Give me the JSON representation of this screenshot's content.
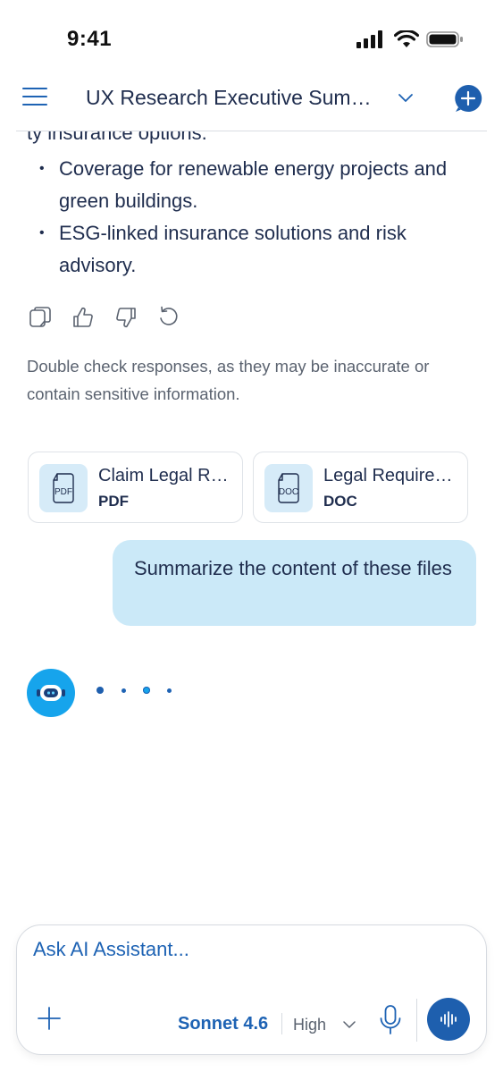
{
  "status_bar": {
    "time": "9:41"
  },
  "header": {
    "title": "UX Research Executive Sum…",
    "menu_icon": "hamburger-menu-icon",
    "dropdown_icon": "chevron-down-icon",
    "new_chat_icon": "chat-plus-icon"
  },
  "conversation": {
    "previous_answer_tail": "ty insurance options.",
    "bullets": [
      "Coverage for renewable energy projects and green buildings.",
      "ESG-linked insurance solutions and risk advisory."
    ],
    "bullet_marker": "•",
    "actions": [
      {
        "name": "copy-icon"
      },
      {
        "name": "thumbs-up-icon"
      },
      {
        "name": "thumbs-down-icon"
      },
      {
        "name": "regenerate-icon"
      }
    ],
    "disclaimer": "Double check responses, as they may be inaccurate or contain sensitive information.",
    "attachments": [
      {
        "name": "Claim Legal R…",
        "type": "PDF",
        "icon_text": "PDF"
      },
      {
        "name": "Legal Require…",
        "type": "DOC",
        "icon_text": "DOC"
      }
    ],
    "user_message": "Summarize the content of these files",
    "assistant_status": "typing"
  },
  "composer": {
    "placeholder": "Ask AI Assistant...",
    "model": "Sonnet 4.6",
    "effort": "High"
  },
  "colors": {
    "accent": "#1e63b4",
    "user_bubble": "#cbe9f8",
    "avatar": "#16a4ec",
    "text": "#1f2d4e",
    "muted": "#5b6370"
  }
}
